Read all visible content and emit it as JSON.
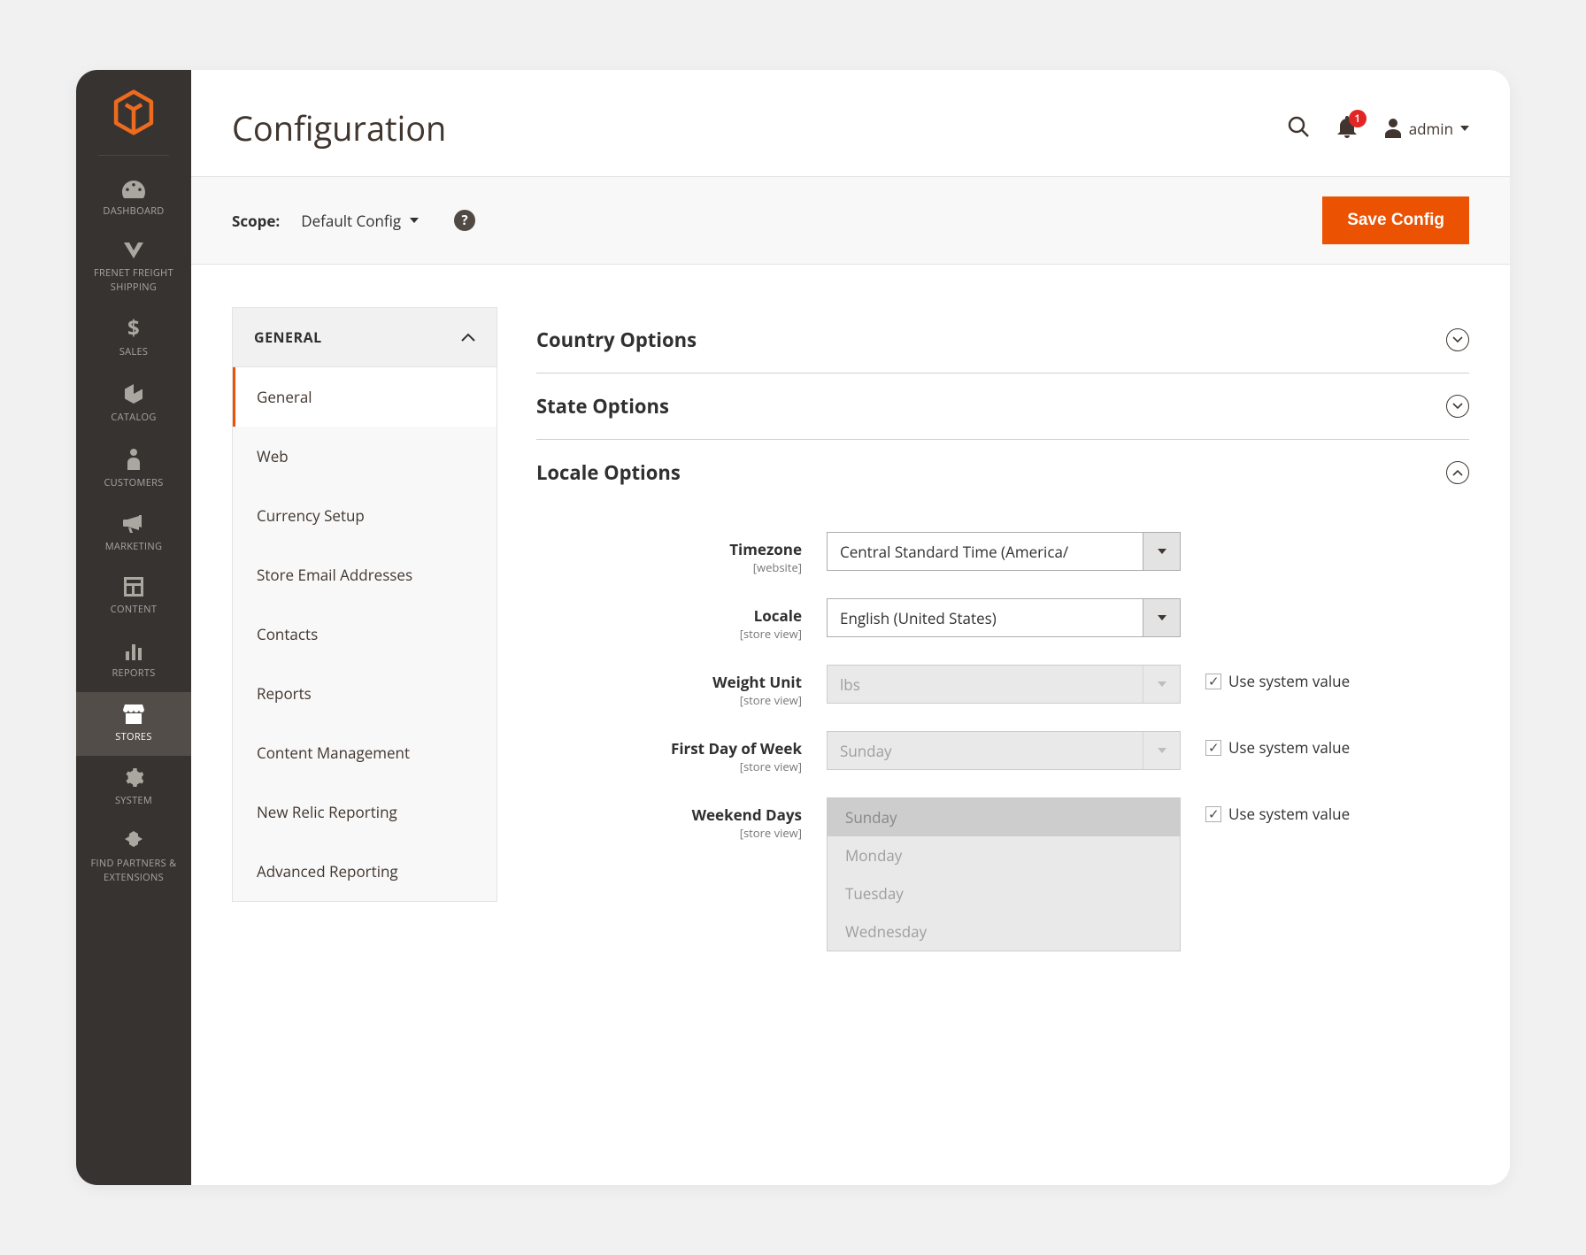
{
  "page": {
    "title": "Configuration"
  },
  "header": {
    "notif_count": "1",
    "user_label": "admin"
  },
  "scope": {
    "label": "Scope:",
    "value": "Default Config",
    "save_label": "Save Config",
    "help": "?"
  },
  "sidebar": {
    "items": [
      {
        "label": "DASHBOARD"
      },
      {
        "label": "FRENET FREIGHT SHIPPING"
      },
      {
        "label": "SALES"
      },
      {
        "label": "CATALOG"
      },
      {
        "label": "CUSTOMERS"
      },
      {
        "label": "MARKETING"
      },
      {
        "label": "CONTENT"
      },
      {
        "label": "REPORTS"
      },
      {
        "label": "STORES"
      },
      {
        "label": "SYSTEM"
      },
      {
        "label": "FIND PARTNERS & EXTENSIONS"
      }
    ]
  },
  "config_tabs": {
    "group": "GENERAL",
    "items": [
      "General",
      "Web",
      "Currency Setup",
      "Store Email Addresses",
      "Contacts",
      "Reports",
      "Content Management",
      "New Relic Reporting",
      "Advanced Reporting"
    ],
    "active_index": 0
  },
  "sections": {
    "country": {
      "title": "Country Options"
    },
    "state": {
      "title": "State Options"
    },
    "locale": {
      "title": "Locale Options",
      "fields": {
        "timezone": {
          "label": "Timezone",
          "scope": "[website]",
          "value": "Central Standard Time (America/"
        },
        "locale": {
          "label": "Locale",
          "scope": "[store view]",
          "value": "English (United States)"
        },
        "weight": {
          "label": "Weight Unit",
          "scope": "[store view]",
          "value": "lbs",
          "use_sys": "Use system value"
        },
        "first_day": {
          "label": "First Day of Week",
          "scope": "[store view]",
          "value": "Sunday",
          "use_sys": "Use system value"
        },
        "weekend": {
          "label": "Weekend Days",
          "scope": "[store view]",
          "use_sys": "Use system value",
          "options": [
            "Sunday",
            "Monday",
            "Tuesday",
            "Wednesday"
          ],
          "selected": "Sunday"
        }
      }
    }
  }
}
